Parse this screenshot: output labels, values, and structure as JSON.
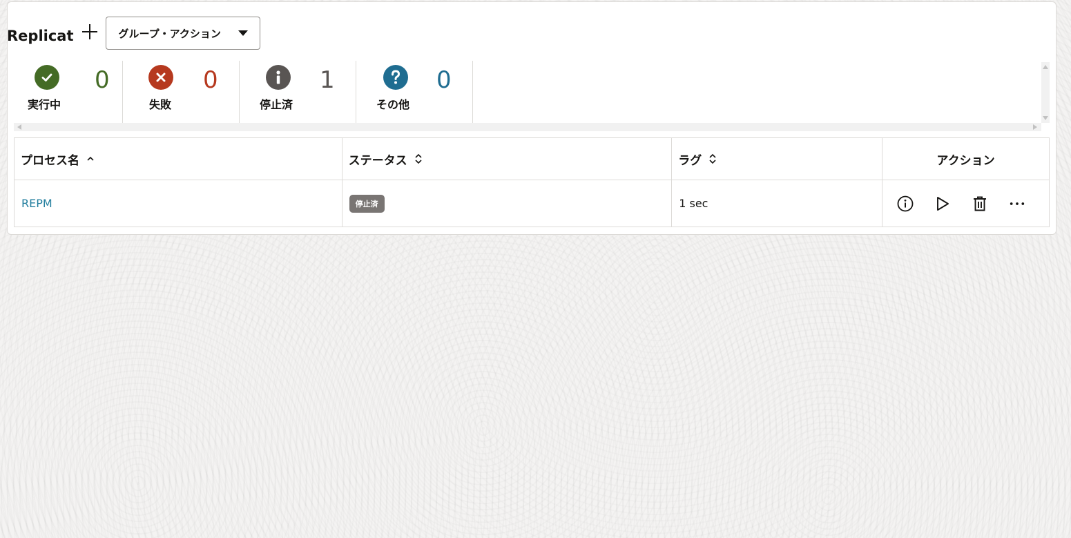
{
  "header": {
    "title": "Replicat",
    "add_icon": "plus-icon",
    "group_action_label": "グループ・アクション"
  },
  "summary": [
    {
      "key": "running",
      "label": "実行中",
      "count": "0",
      "icon": "check-icon",
      "color": "#446b25",
      "count_color": "#446b25"
    },
    {
      "key": "failed",
      "label": "失敗",
      "count": "0",
      "icon": "x-icon",
      "color": "#b6391f",
      "count_color": "#b6391f"
    },
    {
      "key": "stopped",
      "label": "停止済",
      "count": "1",
      "icon": "info-icon",
      "color": "#595553",
      "count_color": "#595553"
    },
    {
      "key": "other",
      "label": "その他",
      "count": "0",
      "icon": "question-icon",
      "color": "#1f6d91",
      "count_color": "#1f6d91"
    }
  ],
  "table": {
    "columns": [
      {
        "label": "プロセス名",
        "sort": "ascending"
      },
      {
        "label": "ステータス",
        "sort": "unsorted"
      },
      {
        "label": "ラグ",
        "sort": "unsorted"
      },
      {
        "label": "アクション",
        "sort": "none"
      }
    ],
    "rows": [
      {
        "name": "REPM",
        "status": "停止済",
        "lag": "1 sec"
      }
    ]
  },
  "row_actions": [
    "info-icon",
    "play-icon",
    "trash-icon",
    "more-icon"
  ]
}
